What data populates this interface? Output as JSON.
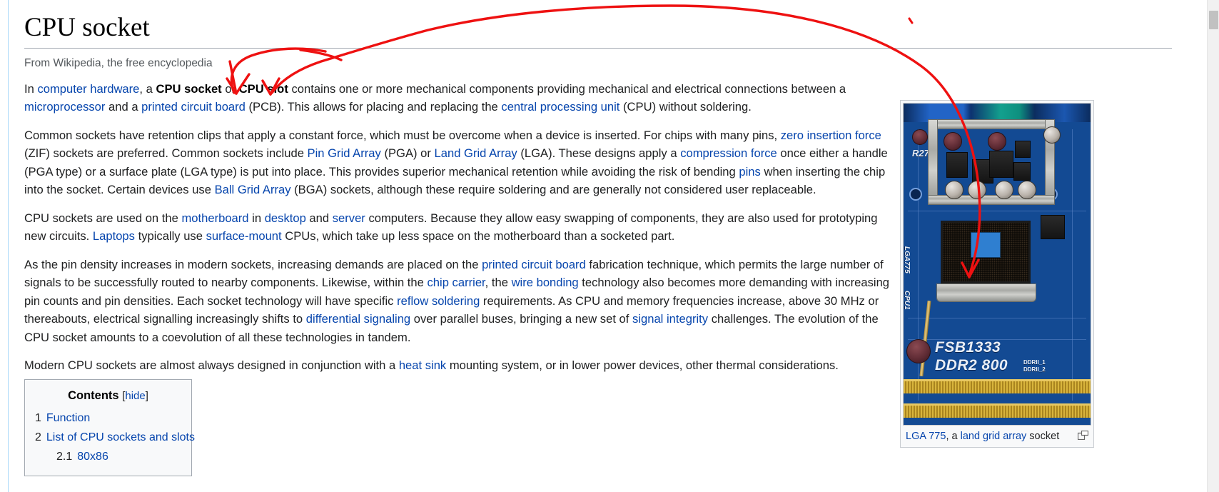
{
  "article": {
    "title": "CPU socket",
    "subtitle": "From Wikipedia, the free encyclopedia"
  },
  "paragraphs": {
    "p1": {
      "s1": "In ",
      "l1": "computer hardware",
      "s2": ", a ",
      "b1": "CPU socket",
      "s3": " or ",
      "b2": "CPU slot",
      "s4": " contains one or more mechanical components providing mechanical and electrical connections between a ",
      "l2": "microprocessor",
      "s5": " and a ",
      "l3": "printed circuit board",
      "s6": " (PCB). This allows for placing and replacing the ",
      "l4": "central processing unit",
      "s7": " (CPU) without soldering."
    },
    "p2": {
      "s1": "Common sockets have retention clips that apply a constant force, which must be overcome when a device is inserted. For chips with many pins, ",
      "l1": "zero insertion force",
      "s2": " (ZIF) sockets are preferred. Common sockets include ",
      "l2": "Pin Grid Array",
      "s3": " (PGA) or ",
      "l3": "Land Grid Array",
      "s4": " (LGA). These designs apply a ",
      "l4": "compression force",
      "s5": " once either a handle (PGA type) or a surface plate (LGA type) is put into place. This provides superior mechanical retention while avoiding the risk of bending ",
      "l5": "pins",
      "s6": " when inserting the chip into the socket. Certain devices use ",
      "l6": "Ball Grid Array",
      "s7": " (BGA) sockets, although these require soldering and are generally not considered user replaceable."
    },
    "p3": {
      "s1": "CPU sockets are used on the ",
      "l1": "motherboard",
      "s2": " in ",
      "l2": "desktop",
      "s3": " and ",
      "l3": "server",
      "s4": " computers. Because they allow easy swapping of components, they are also used for prototyping new circuits. ",
      "l4": "Laptops",
      "s5": " typically use ",
      "l5": "surface-mount",
      "s6": " CPUs, which take up less space on the motherboard than a socketed part."
    },
    "p4": {
      "s1": "As the pin density increases in modern sockets, increasing demands are placed on the ",
      "l1": "printed circuit board",
      "s2": " fabrication technique, which permits the large number of signals to be successfully routed to nearby components. Likewise, within the ",
      "l2": "chip carrier",
      "s3": ", the ",
      "l3": "wire bonding",
      "s4": " technology also becomes more demanding with increasing pin counts and pin densities. Each socket technology will have specific ",
      "l4": "reflow soldering",
      "s5": " requirements. As CPU and memory frequencies increase, above 30 MHz or thereabouts, electrical signalling increasingly shifts to ",
      "l5": "differential signaling",
      "s6": " over parallel buses, bringing a new set of ",
      "l6": "signal integrity",
      "s7": " challenges. The evolution of the CPU socket amounts to a coevolution of all these technologies in tandem."
    },
    "p5": {
      "s1": "Modern CPU sockets are almost always designed in conjunction with a ",
      "l1": "heat sink",
      "s2": " mounting system, or in lower power devices, other thermal considerations."
    }
  },
  "toc": {
    "title": "Contents",
    "hide_open": "[",
    "hide_label": "hide",
    "hide_close": "]",
    "items": [
      {
        "number": "1",
        "text": "Function",
        "level": 1
      },
      {
        "number": "2",
        "text": "List of CPU sockets and slots",
        "level": 1
      },
      {
        "number": "2.1",
        "text": "80x86",
        "level": 2
      }
    ]
  },
  "thumbnail": {
    "caption_link": "LGA 775",
    "caption_rest": ", a ",
    "caption_link2": "land grid array",
    "caption_tail": " socket",
    "silkscreen_fsb": "FSB1333",
    "silkscreen_ddr": "DDR2 800",
    "silkscreen_lga": "LGA775",
    "silkscreen_cpu": "CPU1",
    "silkscreen_r27": "R27",
    "silkscreen_dimm1": "DDRII_1",
    "silkscreen_dimm2": "DDRII_2",
    "magnify_icon": "enlarge-icon"
  },
  "annotation": {
    "color": "#ee1111",
    "description": "red-ink-arrows"
  },
  "colors": {
    "link": "#0645ad",
    "text": "#202122",
    "subtitle": "#54595d",
    "rule": "#a2a9b1",
    "toc_bg": "#f8f9fa",
    "annotation_red": "#ee1111",
    "scrollbar_track": "#f1f1f1",
    "scrollbar_thumb": "#c1c1c1"
  },
  "scrollbar": {
    "position_label": "near-top"
  }
}
